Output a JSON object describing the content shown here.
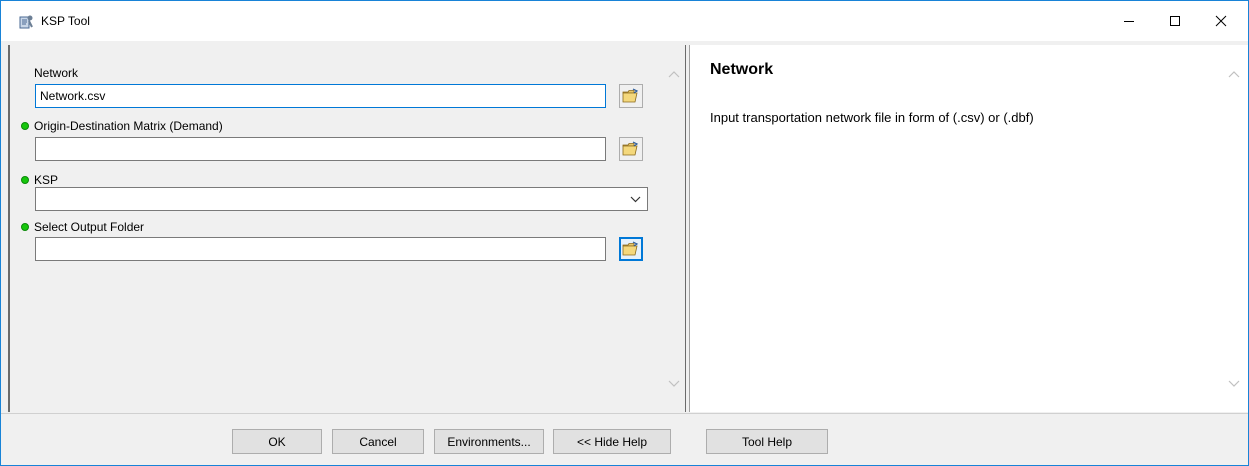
{
  "window": {
    "title": "KSP Tool",
    "icons": {
      "app": "ksp-tool-icon",
      "minimize": "minimize-icon",
      "maximize": "maximize-icon",
      "close": "close-icon"
    }
  },
  "params": [
    {
      "label": "Network",
      "value": "Network.csv",
      "required": false,
      "kind": "file",
      "icon": "open-folder-icon"
    },
    {
      "label": "Origin-Destination Matrix (Demand)",
      "value": "",
      "required": true,
      "kind": "file",
      "icon": "open-folder-icon"
    },
    {
      "label": "KSP",
      "value": "",
      "required": true,
      "kind": "dropdown",
      "icon": "chevron-down-icon"
    },
    {
      "label": "Select Output Folder",
      "value": "",
      "required": true,
      "kind": "folder",
      "icon": "open-folder-icon"
    }
  ],
  "help": {
    "title": "Network",
    "text": "Input transportation network file in form of (.csv) or (.dbf)"
  },
  "buttons": {
    "ok": "OK",
    "cancel": "Cancel",
    "environments": "Environments...",
    "hide_help": "<< Hide Help",
    "tool_help": "Tool Help"
  },
  "colors": {
    "required_dot": "#16c60c",
    "focus_border": "#0078d7",
    "window_border": "#1883d7"
  }
}
